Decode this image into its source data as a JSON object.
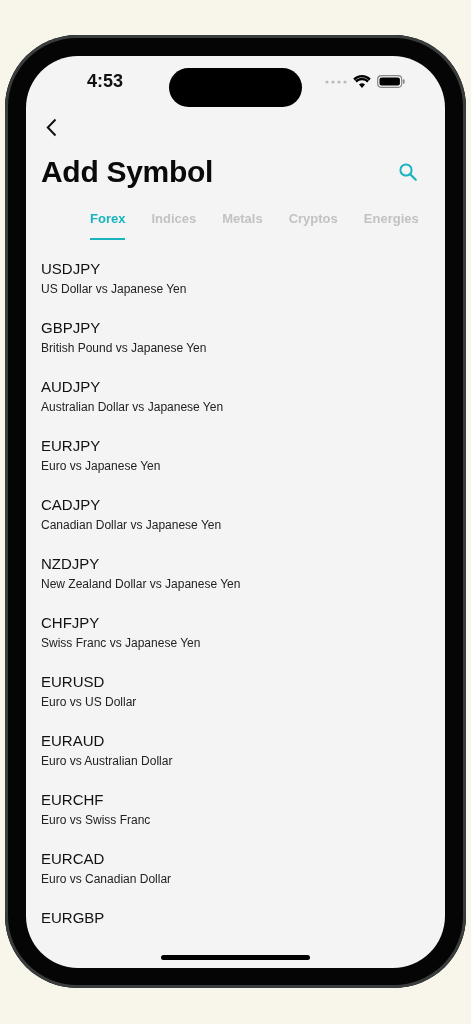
{
  "status_bar": {
    "time": "4:53"
  },
  "header": {
    "title": "Add Symbol"
  },
  "tabs": [
    {
      "label": "Forex",
      "selected": true
    },
    {
      "label": "Indices",
      "selected": false
    },
    {
      "label": "Metals",
      "selected": false
    },
    {
      "label": "Cryptos",
      "selected": false
    },
    {
      "label": "Energies",
      "selected": false
    }
  ],
  "symbols": [
    {
      "symbol": "USDJPY",
      "description": "US Dollar vs Japanese Yen"
    },
    {
      "symbol": "GBPJPY",
      "description": "British Pound vs Japanese Yen"
    },
    {
      "symbol": "AUDJPY",
      "description": "Australian Dollar vs Japanese Yen"
    },
    {
      "symbol": "EURJPY",
      "description": "Euro vs Japanese Yen"
    },
    {
      "symbol": "CADJPY",
      "description": "Canadian Dollar vs Japanese Yen"
    },
    {
      "symbol": "NZDJPY",
      "description": "New Zealand Dollar vs Japanese Yen"
    },
    {
      "symbol": "CHFJPY",
      "description": "Swiss Franc vs Japanese Yen"
    },
    {
      "symbol": "EURUSD",
      "description": "Euro vs US Dollar"
    },
    {
      "symbol": "EURAUD",
      "description": "Euro vs Australian Dollar"
    },
    {
      "symbol": "EURCHF",
      "description": "Euro vs Swiss Franc"
    },
    {
      "symbol": "EURCAD",
      "description": "Euro vs Canadian Dollar"
    },
    {
      "symbol": "EURGBP"
    }
  ]
}
